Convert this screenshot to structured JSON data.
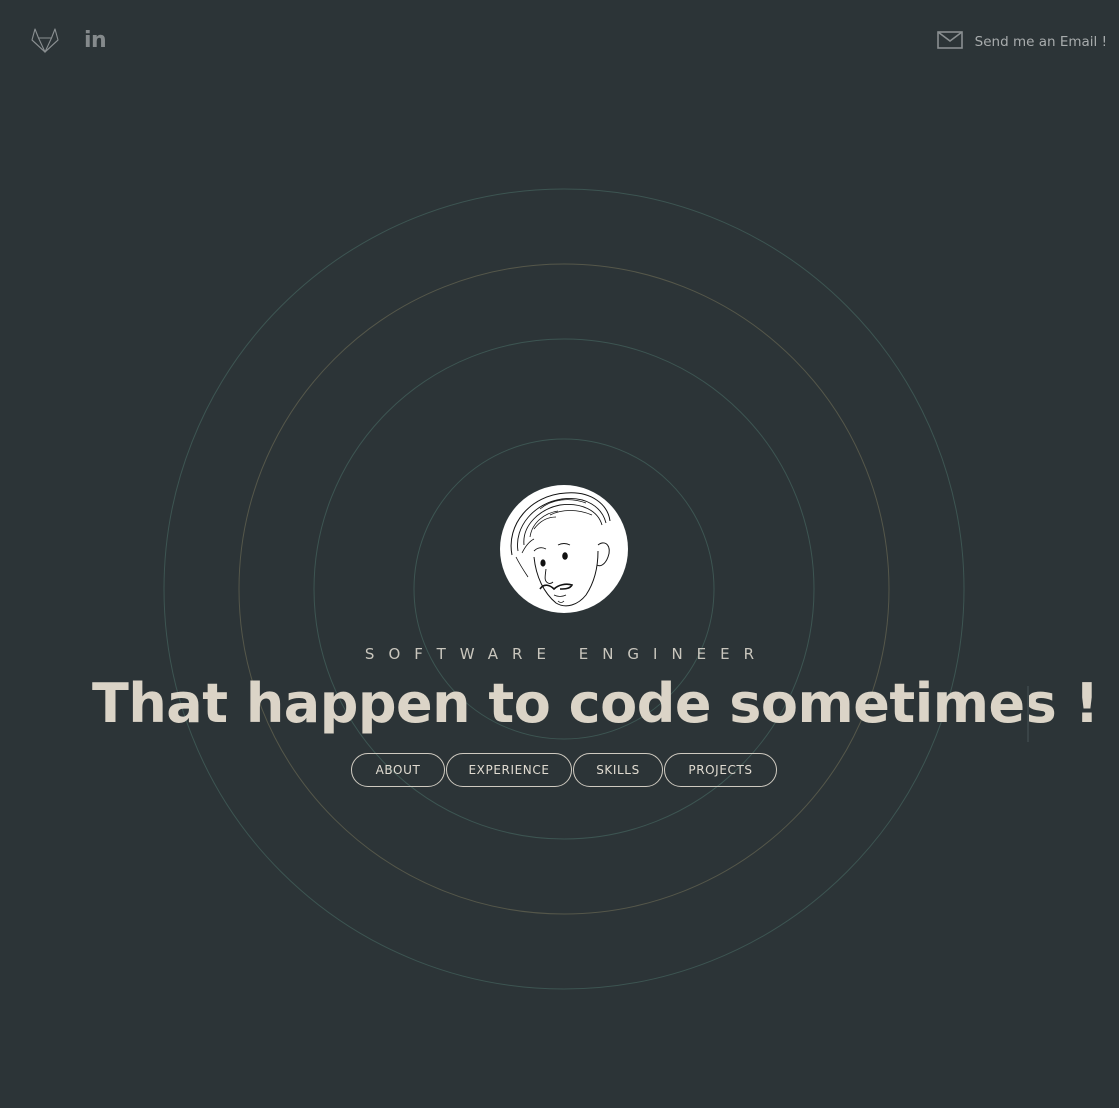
{
  "header": {
    "social": [
      {
        "name": "gitlab",
        "icon": "gitlab-icon"
      },
      {
        "name": "linkedin",
        "icon": "linkedin-icon",
        "glyph": "in"
      }
    ],
    "email_label": "Send me an Email !",
    "email_icon": "envelope-icon"
  },
  "hero": {
    "avatar_icon": "avatar-sketch-face",
    "subtitle": "SOFTWARE ENGINEER",
    "headline": "That happen to code sometimes !"
  },
  "nav": {
    "about": "ABOUT",
    "experience": "EXPERIENCE",
    "skills": "SKILLS",
    "projects": "PROJECTS"
  },
  "colors": {
    "background": "#2c3437",
    "headline": "#dbd4c7",
    "ring_teal": "#3f5a57",
    "ring_gold": "#5a5a45"
  }
}
